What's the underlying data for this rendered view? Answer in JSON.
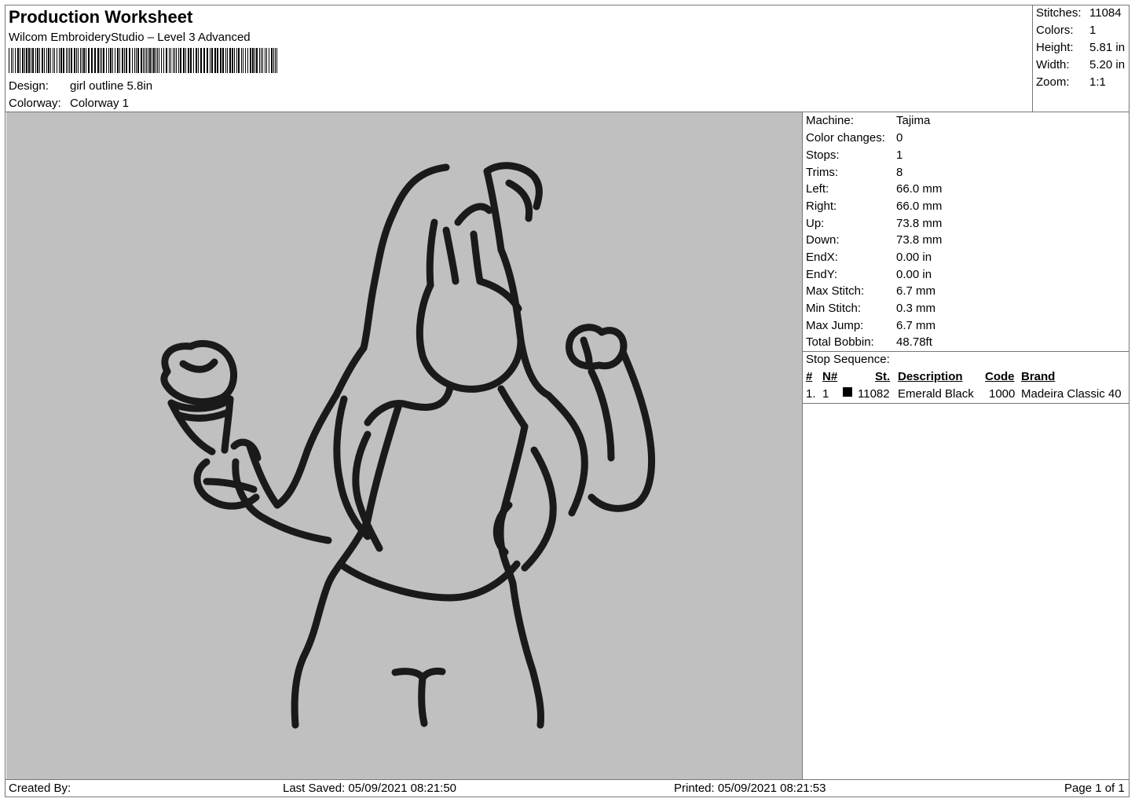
{
  "header": {
    "title": "Production Worksheet",
    "software": "Wilcom EmbroideryStudio – Level 3 Advanced",
    "design_label": "Design:",
    "design_value": "girl outline 5.8in",
    "colorway_label": "Colorway:",
    "colorway_value": "Colorway 1"
  },
  "summary": [
    {
      "label": "Stitches:",
      "value": "11084"
    },
    {
      "label": "Colors:",
      "value": "1"
    },
    {
      "label": "Height:",
      "value": "5.81 in"
    },
    {
      "label": "Width:",
      "value": "5.20 in"
    },
    {
      "label": "Zoom:",
      "value": "1:1"
    }
  ],
  "machine_info": [
    {
      "label": "Machine:",
      "value": "Tajima"
    },
    {
      "label": "Color changes:",
      "value": "0"
    },
    {
      "label": "Stops:",
      "value": "1"
    },
    {
      "label": "Trims:",
      "value": "8"
    },
    {
      "label": "Left:",
      "value": "66.0 mm"
    },
    {
      "label": "Right:",
      "value": "66.0 mm"
    },
    {
      "label": "Up:",
      "value": "73.8 mm"
    },
    {
      "label": "Down:",
      "value": "73.8 mm"
    },
    {
      "label": "EndX:",
      "value": "0.00 in"
    },
    {
      "label": "EndY:",
      "value": "0.00 in"
    },
    {
      "label": "Max Stitch:",
      "value": "6.7 mm"
    },
    {
      "label": "Min Stitch:",
      "value": "0.3 mm"
    },
    {
      "label": "Max Jump:",
      "value": "6.7 mm"
    },
    {
      "label": "Total Bobbin:",
      "value": "48.78ft"
    }
  ],
  "stop_sequence": {
    "title": "Stop Sequence:",
    "columns": {
      "num": "#",
      "needle": "N#",
      "stitches": "St.",
      "description": "Description",
      "code": "Code",
      "brand": "Brand"
    },
    "rows": [
      {
        "num": "1.",
        "needle": "1",
        "color": "#000000",
        "stitches": "11082",
        "description": "Emerald Black",
        "code": "1000",
        "brand": "Madeira Classic 40"
      }
    ]
  },
  "footer": {
    "created_by": "Created By:",
    "last_saved": "Last Saved: 05/09/2021 08:21:50",
    "printed": "Printed: 05/09/2021 08:21:53",
    "page": "Page 1 of 1"
  },
  "colors": {
    "canvas_background": "#c0c0c0",
    "thread": "#1a1a1a"
  }
}
